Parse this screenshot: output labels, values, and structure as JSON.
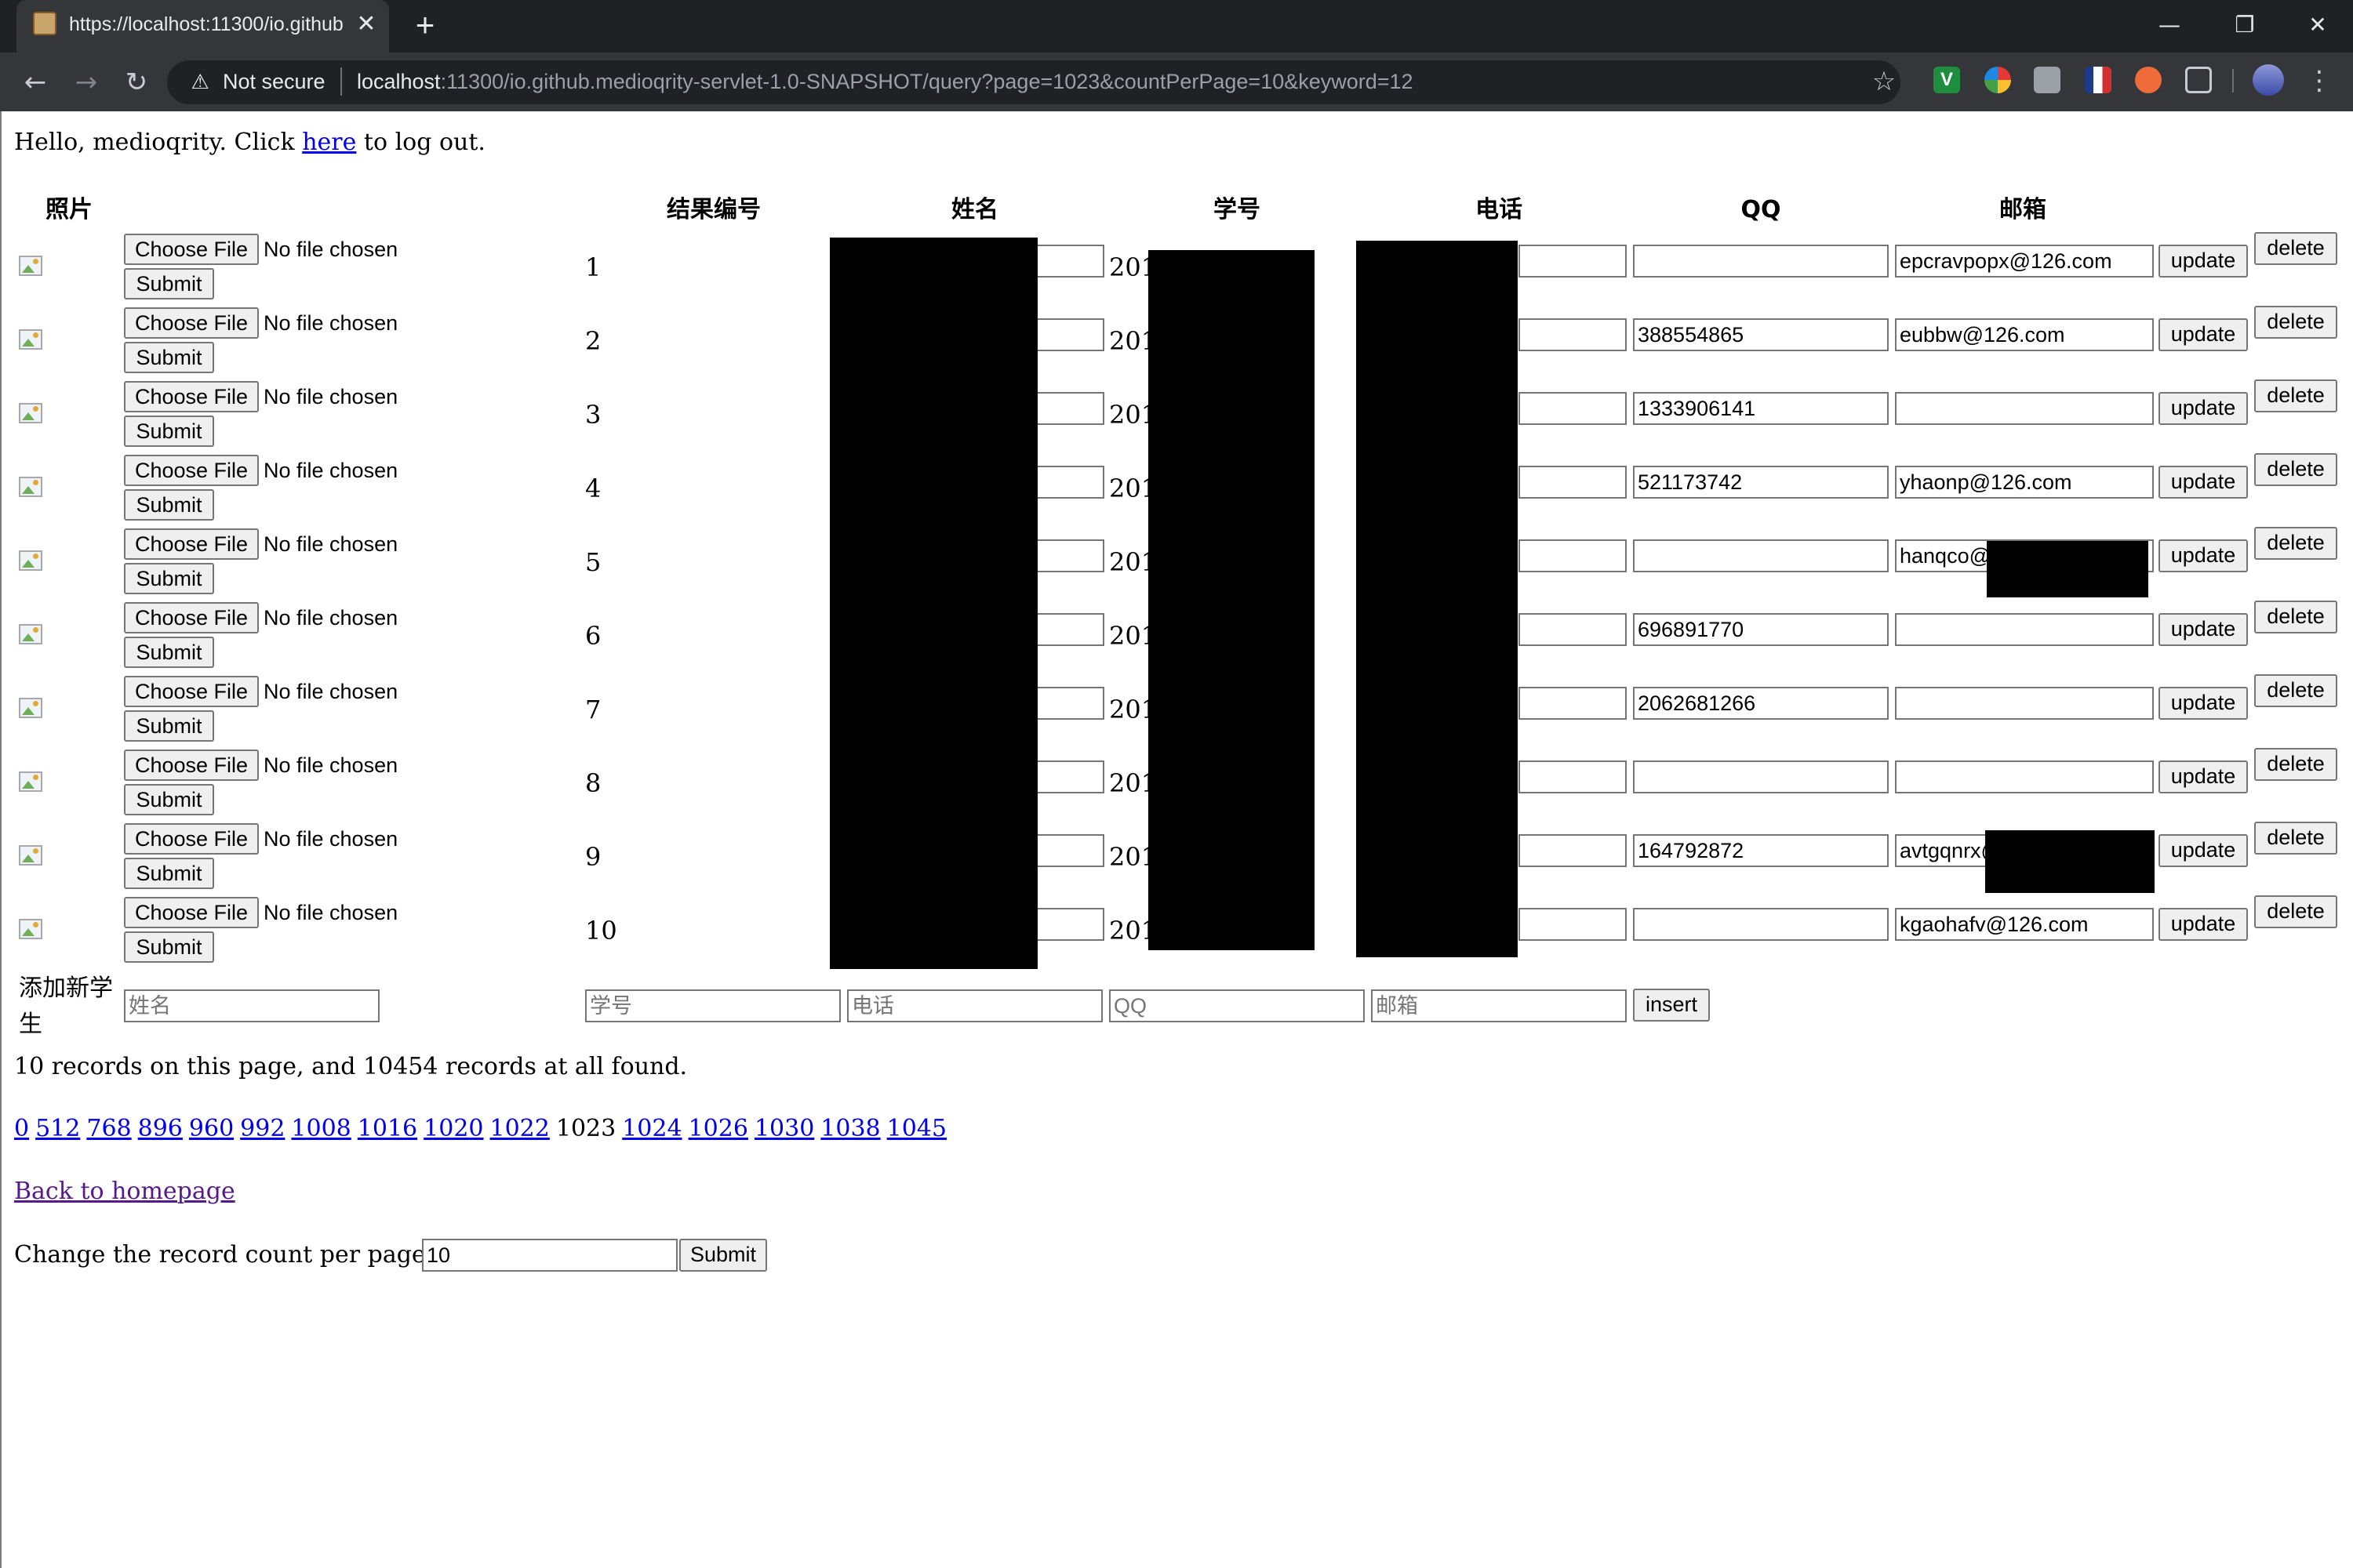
{
  "browser": {
    "tab_title": "https://localhost:11300/io.github",
    "tab_close": "✕",
    "new_tab": "+",
    "window_controls": {
      "minimize": "—",
      "maximize": "❐",
      "close": "✕"
    },
    "nav": {
      "back": "←",
      "forward": "→",
      "reload": "↻"
    },
    "security_warning_icon": "⚠",
    "security_label": "Not secure",
    "url_host": "localhost",
    "url_rest": ":11300/io.github.medioqrity-servlet-1.0-SNAPSHOT/query?page=1023&countPerPage=10&keyword=12",
    "bookmark_icon": "☆",
    "extension_v_label": "V",
    "menu_icon": "⋮",
    "icons": [
      "warning-icon",
      "star-icon",
      "kebab-menu-icon",
      "back-arrow-icon",
      "forward-arrow-icon",
      "reload-icon"
    ]
  },
  "page": {
    "greeting_prefix": "Hello, medioqrity. Click ",
    "greeting_link": "here",
    "greeting_suffix": " to log out.",
    "headers": {
      "photo": "照片",
      "result_no": "结果编号",
      "name": "姓名",
      "student_id": "学号",
      "phone": "电话",
      "qq": "QQ",
      "email": "邮箱"
    },
    "file_input": {
      "choose_label": "Choose File",
      "status": "No file chosen",
      "submit_label": "Submit"
    },
    "row_buttons": {
      "update": "update",
      "delete": "delete"
    },
    "student_id_visible_prefix": "201",
    "rows": [
      {
        "num": "1",
        "qq": "",
        "email": "epcravpopx@126.com"
      },
      {
        "num": "2",
        "qq": "388554865",
        "email": "eubbw@126.com"
      },
      {
        "num": "3",
        "qq": "1333906141",
        "email": ""
      },
      {
        "num": "4",
        "qq": "521173742",
        "email": "yhaonp@126.com"
      },
      {
        "num": "5",
        "qq": "",
        "email": "hanqco@"
      },
      {
        "num": "6",
        "qq": "696891770",
        "email": ""
      },
      {
        "num": "7",
        "qq": "2062681266",
        "email": ""
      },
      {
        "num": "8",
        "qq": "",
        "email": ""
      },
      {
        "num": "9",
        "qq": "164792872",
        "email": "avtgqnrx@"
      },
      {
        "num": "10",
        "qq": "",
        "email": "kgaohafv@126.com"
      }
    ],
    "add_new": {
      "label": "添加新学生",
      "name_placeholder": "姓名",
      "student_id_placeholder": "学号",
      "phone_placeholder": "电话",
      "qq_placeholder": "QQ",
      "email_placeholder": "邮箱",
      "insert_label": "insert"
    },
    "records_summary": "10 records on this page, and 10454 records at all found.",
    "pagination": {
      "current": "1023",
      "before": [
        "0",
        "512",
        "768",
        "896",
        "960",
        "992",
        "1008",
        "1016",
        "1020",
        "1022"
      ],
      "after": [
        "1024",
        "1026",
        "1030",
        "1038",
        "1045"
      ]
    },
    "back_link": "Back to homepage",
    "count_per_page_label": "Change the record count per page:",
    "count_per_page_value": "10",
    "count_submit_label": "Submit"
  }
}
